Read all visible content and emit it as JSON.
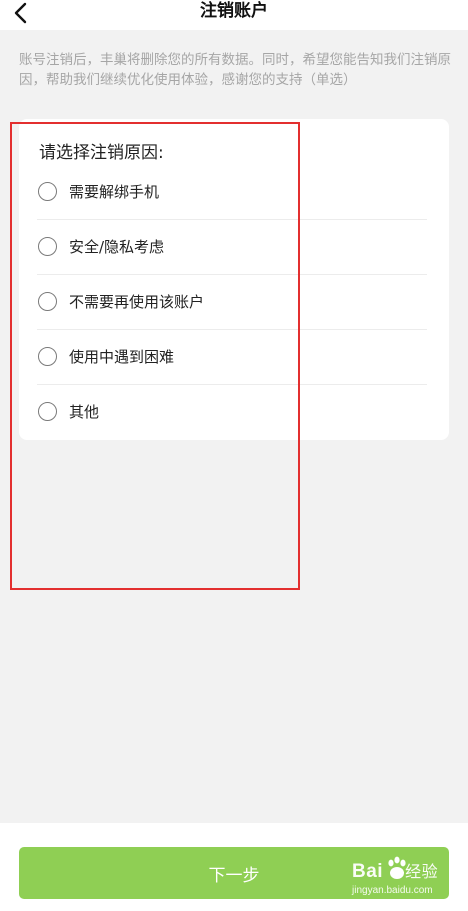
{
  "header": {
    "title": "注销账户",
    "back_icon": "chevron-left-icon"
  },
  "notice": {
    "text": "账号注销后，丰巢将删除您的所有数据。同时，希望您能告知我们注销原因，帮助我们继续优化使用体验，感谢您的支持（单选）"
  },
  "reasons": {
    "title": "请选择注销原因:",
    "options": [
      {
        "label": "需要解绑手机",
        "selected": false
      },
      {
        "label": "安全/隐私考虑",
        "selected": false
      },
      {
        "label": "不需要再使用该账户",
        "selected": false
      },
      {
        "label": "使用中遇到困难",
        "selected": false
      },
      {
        "label": "其他",
        "selected": false
      }
    ]
  },
  "footer": {
    "next_label": "下一步"
  },
  "watermark": {
    "logo_text": "Bai",
    "logo_text2": "经验",
    "site": "jingyan.baidu.com"
  },
  "colors": {
    "accent": "#8fcf54",
    "highlight_box": "#e32f2f",
    "background": "#f2f2f2"
  }
}
